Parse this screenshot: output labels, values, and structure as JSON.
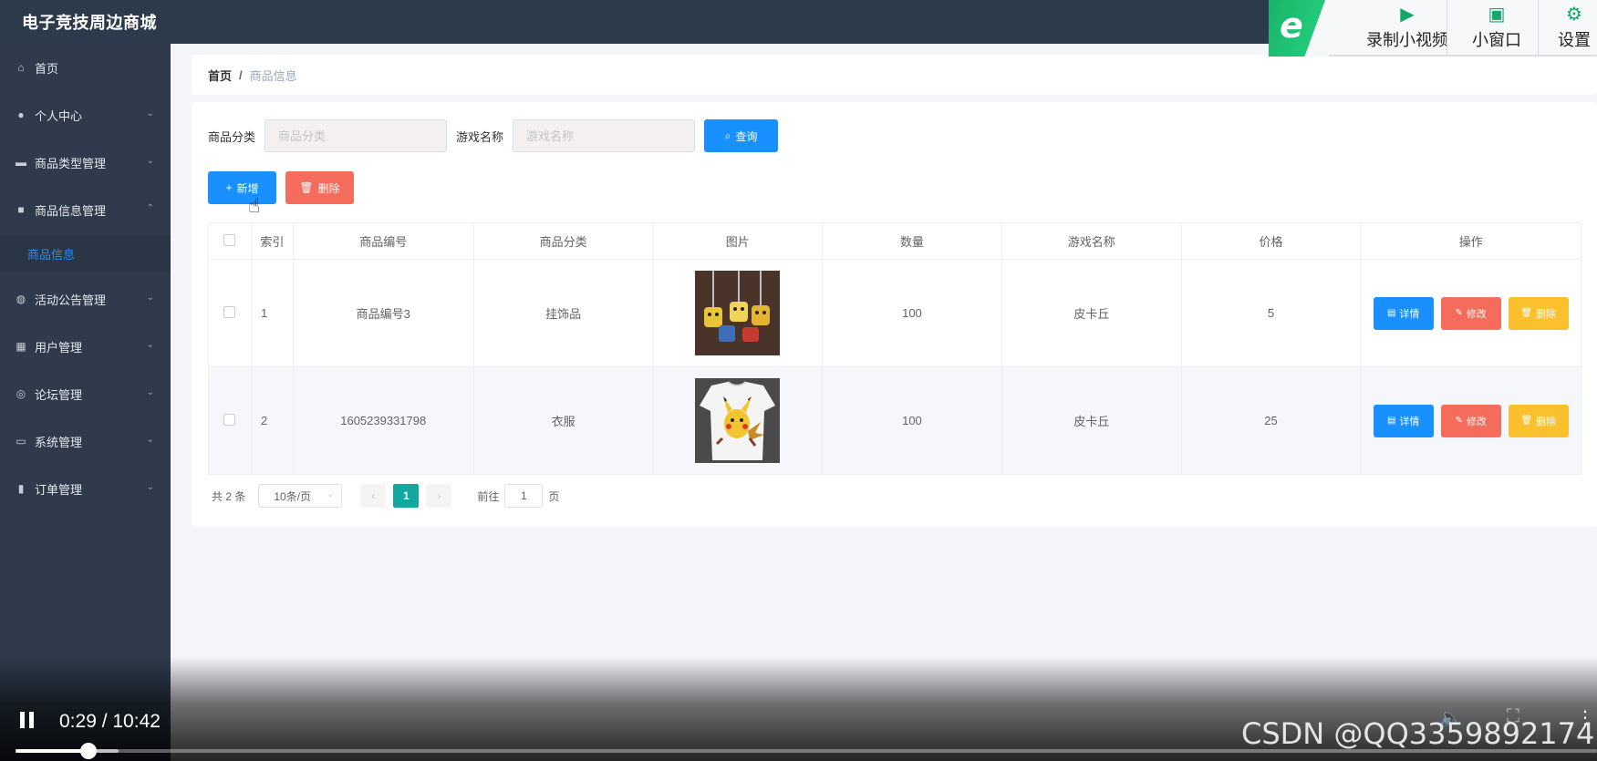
{
  "app": {
    "title": "电子竞技周边商城"
  },
  "sidebar": {
    "items": [
      {
        "label": "首页",
        "icon": "home-icon",
        "glyph": "⌂",
        "has_chevron": false
      },
      {
        "label": "个人中心",
        "icon": "user-icon",
        "glyph": "●",
        "has_chevron": true
      },
      {
        "label": "商品类型管理",
        "icon": "monitor-icon",
        "glyph": "▬",
        "has_chevron": true
      },
      {
        "label": "商品信息管理",
        "icon": "briefcase-icon",
        "glyph": "■",
        "has_chevron": true,
        "expanded": true
      },
      {
        "label": "活动公告管理",
        "icon": "globe-icon",
        "glyph": "◍",
        "has_chevron": true
      },
      {
        "label": "用户管理",
        "icon": "grid-icon",
        "glyph": "▦",
        "has_chevron": true
      },
      {
        "label": "论坛管理",
        "icon": "circle-icon",
        "glyph": "◎",
        "has_chevron": true
      },
      {
        "label": "系统管理",
        "icon": "chart-icon",
        "glyph": "▭",
        "has_chevron": true
      },
      {
        "label": "订单管理",
        "icon": "bar-chart-icon",
        "glyph": "▮",
        "has_chevron": true
      }
    ],
    "active_sub": "商品信息"
  },
  "breadcrumb": {
    "home": "首页",
    "separator": "/",
    "current": "商品信息"
  },
  "search": {
    "category_label": "商品分类",
    "category_placeholder": "商品分类",
    "game_label": "游戏名称",
    "game_placeholder": "游戏名称",
    "query_button": "查询"
  },
  "actions": {
    "add": "新增",
    "delete": "删除"
  },
  "table": {
    "columns": [
      "索引",
      "商品编号",
      "商品分类",
      "图片",
      "数量",
      "游戏名称",
      "价格",
      "操作"
    ],
    "rows": [
      {
        "index": "1",
        "code": "商品编号3",
        "category": "挂饰品",
        "image": "keychain-photo",
        "quantity": "100",
        "game": "皮卡丘",
        "price": "5"
      },
      {
        "index": "2",
        "code": "1605239331798",
        "category": "衣服",
        "image": "tshirt-photo",
        "quantity": "100",
        "game": "皮卡丘",
        "price": "25"
      }
    ],
    "row_actions": {
      "detail": "详情",
      "edit": "修改",
      "remove": "删除"
    }
  },
  "pagination": {
    "total": "共 2 条",
    "page_size": "10条/页",
    "current_page": "1",
    "goto_label": "前往",
    "goto_value": "1",
    "page_suffix": "页"
  },
  "recorder": {
    "record_label": "录制小视频",
    "window_label": "小窗口",
    "settings_label": "设置"
  },
  "video": {
    "time": "0:29 / 10:42",
    "watermark": "CSDN @QQ3359892174",
    "played_fraction": 0.046,
    "buffered_fraction": 0.065
  },
  "colors": {
    "primary": "#1890ff",
    "danger": "#f56c5c",
    "warning": "#fbc02d",
    "sidebar_bg": "#2f3b4c",
    "topbar_bg": "#2d3a4b",
    "pager_active": "#13a89e"
  }
}
